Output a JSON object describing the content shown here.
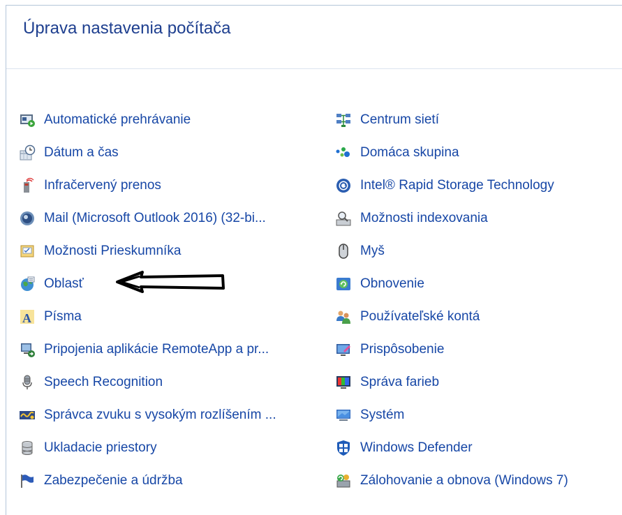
{
  "page": {
    "title": "Úprava nastavenia počítača"
  },
  "left_column": [
    {
      "label": "Automatické prehrávanie",
      "icon": "autoplay-icon"
    },
    {
      "label": "Dátum a čas",
      "icon": "clock-icon"
    },
    {
      "label": "Infračervený prenos",
      "icon": "infrared-icon"
    },
    {
      "label": "Mail (Microsoft Outlook 2016) (32-bi...",
      "icon": "mail-icon"
    },
    {
      "label": "Možnosti Prieskumníka",
      "icon": "folder-options-icon"
    },
    {
      "label": "Oblasť",
      "icon": "region-globe-icon"
    },
    {
      "label": "Písma",
      "icon": "fonts-icon"
    },
    {
      "label": "Pripojenia aplikácie RemoteApp a pr...",
      "icon": "remoteapp-icon"
    },
    {
      "label": "Speech Recognition",
      "icon": "microphone-icon"
    },
    {
      "label": "Správca zvuku s vysokým rozlíšením ...",
      "icon": "audio-manager-icon"
    },
    {
      "label": "Ukladacie priestory",
      "icon": "storage-spaces-icon"
    },
    {
      "label": "Zabezpečenie a údržba",
      "icon": "flag-icon"
    }
  ],
  "right_column": [
    {
      "label": "Centrum sietí",
      "icon": "network-center-icon"
    },
    {
      "label": "Domáca skupina",
      "icon": "homegroup-icon"
    },
    {
      "label": "Intel® Rapid Storage Technology",
      "icon": "intel-rst-icon"
    },
    {
      "label": "Možnosti indexovania",
      "icon": "indexing-icon"
    },
    {
      "label": "Myš",
      "icon": "mouse-icon"
    },
    {
      "label": "Obnovenie",
      "icon": "recovery-icon"
    },
    {
      "label": "Používateľské kontá",
      "icon": "user-accounts-icon"
    },
    {
      "label": "Prispôsobenie",
      "icon": "personalization-icon"
    },
    {
      "label": "Správa farieb",
      "icon": "color-management-icon"
    },
    {
      "label": "Systém",
      "icon": "system-icon"
    },
    {
      "label": "Windows Defender",
      "icon": "windows-defender-icon"
    },
    {
      "label": "Zálohovanie a obnova (Windows 7)",
      "icon": "backup-restore-icon"
    }
  ],
  "annotation": {
    "arrow_icon": "hand-drawn-arrow-icon"
  },
  "colors": {
    "link": "#1747a6",
    "title": "#1e3f8f",
    "border": "#b4c6d9"
  }
}
